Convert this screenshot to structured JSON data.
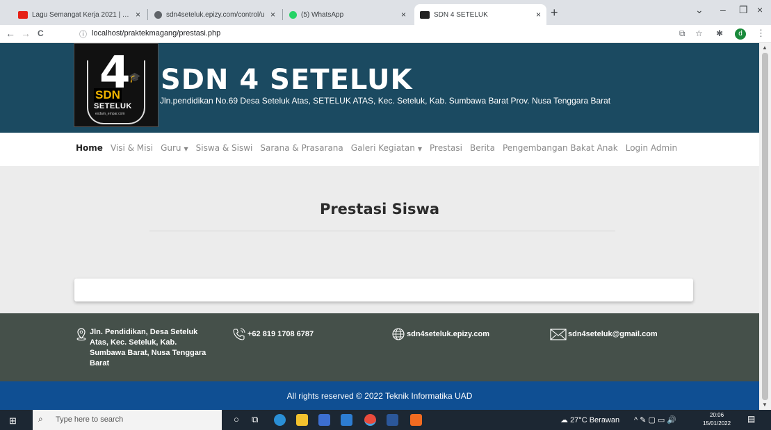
{
  "browser": {
    "tabs": [
      {
        "title": "Lagu Semangat Kerja 2021 | Top",
        "favicon_color": "#e62117",
        "close": "×"
      },
      {
        "title": "sdn4seteluk.epizy.com/control/u",
        "favicon_color": "#5f6368",
        "close": "×"
      },
      {
        "title": "(5) WhatsApp",
        "favicon_color": "#25d366",
        "close": "×"
      },
      {
        "title": "SDN 4 SETELUK",
        "favicon_color": "#222222",
        "close": "×"
      }
    ],
    "new_tab": "+",
    "window_controls": {
      "dropdown": "⌄",
      "minimize": "–",
      "maximize": "❐",
      "close": "×"
    },
    "nav": {
      "back": "←",
      "forward": "→",
      "reload": "C"
    },
    "url": "localhost/praktekmagang/prestasi.php",
    "profile_initial": "d"
  },
  "site": {
    "logo": {
      "number": "4",
      "abbr": "SDN",
      "sub": "SETELUK",
      "tag": "exdam_empar.com"
    },
    "name": "SDN 4 SETELUK",
    "address": "Jln.pendidikan No.69 Desa Seteluk Atas, SETELUK ATAS, Kec. Seteluk, Kab. Sumbawa Barat Prov. Nusa Tenggara Barat",
    "colors": {
      "header": "#1b4a61",
      "footer": "#45504a",
      "copyright_bar": "#0f4f93"
    }
  },
  "nav": [
    {
      "label": "Home",
      "active": true
    },
    {
      "label": "Visi & Misi"
    },
    {
      "label": "Guru",
      "dropdown": true
    },
    {
      "label": "Siswa & Siswi"
    },
    {
      "label": "Sarana & Prasarana"
    },
    {
      "label": "Galeri Kegiatan",
      "dropdown": true
    },
    {
      "label": "Prestasi"
    },
    {
      "label": "Berita"
    },
    {
      "label": "Pengembangan Bakat Anak"
    },
    {
      "label": "Login Admin"
    }
  ],
  "main": {
    "title": "Prestasi Siswa"
  },
  "footer": {
    "address": "Jln. Pendidikan, Desa Seteluk Atas, Kec. Seteluk, Kab. Sumbawa Barat, Nusa Tenggara Barat",
    "phone": "+62 819 1708 6787",
    "website": "sdn4seteluk.epizy.com",
    "email": "sdn4seteluk@gmail.com",
    "copyright": "All rights reserved © 2022 Teknik Informatika UAD"
  },
  "taskbar": {
    "search_placeholder": "Type here to search",
    "weather": "27°C  Berawan",
    "time": "20:06",
    "date": "15/01/2022"
  }
}
